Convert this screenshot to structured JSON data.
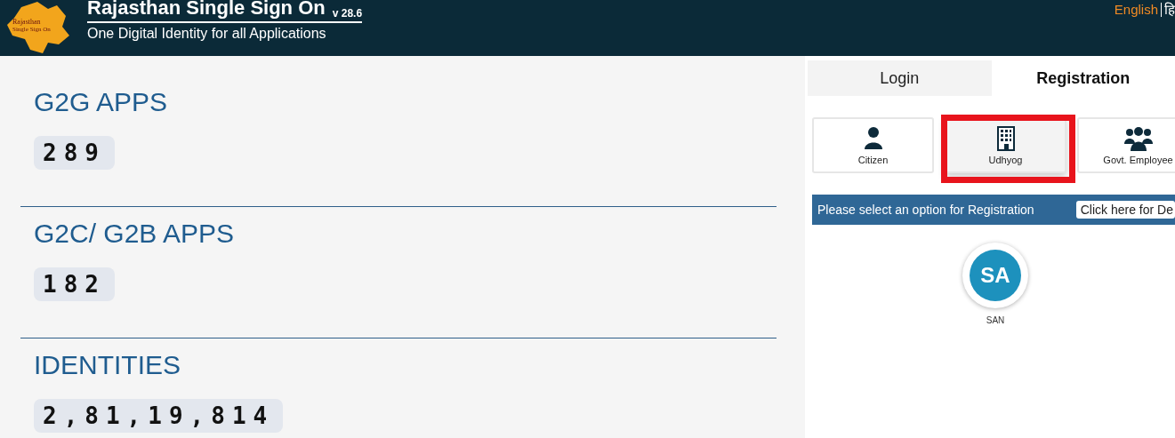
{
  "header": {
    "logo_text": [
      "Rajasthan",
      "Single Sign On"
    ],
    "title": "Rajasthan Single Sign On",
    "version": "v 28.6",
    "subtitle": "One Digital Identity for all Applications",
    "languages": [
      {
        "label": "English",
        "selected": true
      },
      {
        "label": "हि",
        "selected": false
      }
    ]
  },
  "stats": [
    {
      "title": "G2G APPS",
      "count": "289"
    },
    {
      "title": "G2C/ G2B APPS",
      "count": "182"
    },
    {
      "title": "IDENTITIES",
      "count": "2,81,19,814"
    }
  ],
  "tabs": [
    {
      "label": "Login",
      "selected": false
    },
    {
      "label": "Registration",
      "selected": true
    }
  ],
  "options": [
    {
      "label": "Citizen",
      "kind": "person",
      "selected": false,
      "highlighted": false
    },
    {
      "label": "Udhyog",
      "kind": "building",
      "selected": true,
      "highlighted": true
    },
    {
      "label": "Govt. Employee",
      "kind": "group",
      "selected": false,
      "highlighted": false
    }
  ],
  "notice": {
    "text": "Please select an option for Registration",
    "button": "Click here for De"
  },
  "apps": [
    {
      "badge": "SA",
      "label": "SAN"
    }
  ]
}
